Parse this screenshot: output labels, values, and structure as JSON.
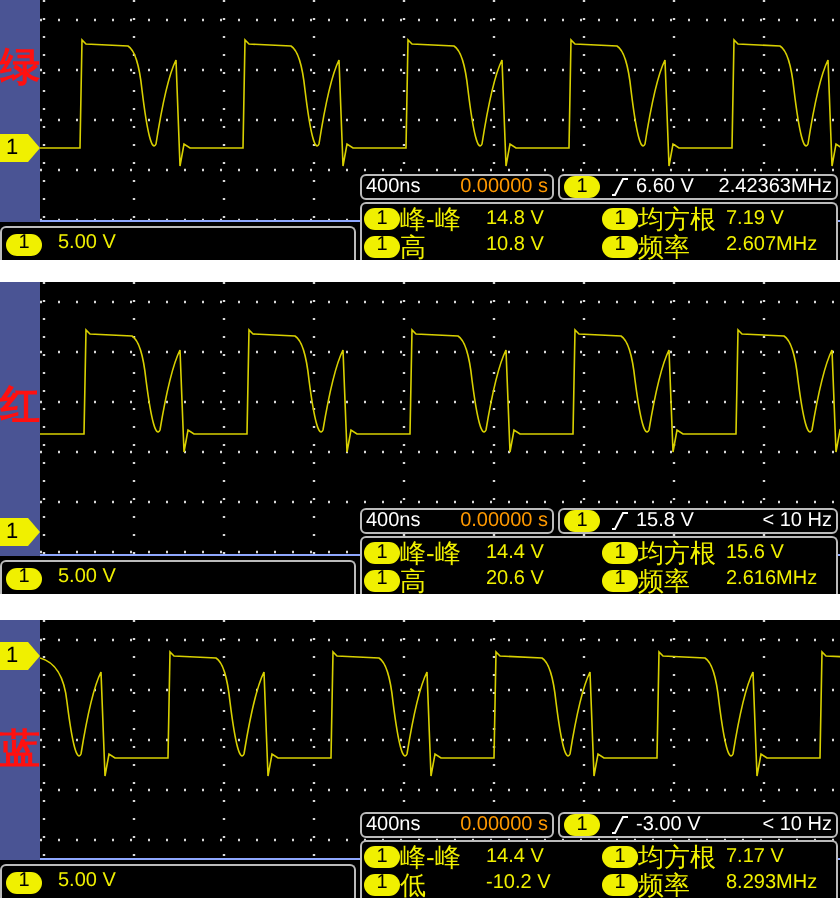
{
  "panels": [
    {
      "color_label": "绿",
      "channel_marker": "1",
      "timebase": "400ns",
      "trigger_position": "0.00000 s",
      "trigger": {
        "channel": "1",
        "level": "6.60 V",
        "frequency": "2.42363MHz"
      },
      "scale": {
        "channel": "1",
        "value": "5.00 V"
      },
      "measurements": [
        {
          "channel": "1",
          "name": "峰-峰",
          "value": "14.8 V"
        },
        {
          "channel": "1",
          "name": "均方根",
          "value": "7.19 V"
        },
        {
          "channel": "1",
          "name": "高",
          "value": "10.8 V"
        },
        {
          "channel": "1",
          "name": "频率",
          "value": "2.607MHz"
        }
      ]
    },
    {
      "color_label": "红",
      "channel_marker": "1",
      "timebase": "400ns",
      "trigger_position": "0.00000 s",
      "trigger": {
        "channel": "1",
        "level": "15.8 V",
        "frequency": "< 10 Hz"
      },
      "scale": {
        "channel": "1",
        "value": "5.00 V"
      },
      "measurements": [
        {
          "channel": "1",
          "name": "峰-峰",
          "value": "14.4 V"
        },
        {
          "channel": "1",
          "name": "均方根",
          "value": "15.6 V"
        },
        {
          "channel": "1",
          "name": "高",
          "value": "20.6 V"
        },
        {
          "channel": "1",
          "name": "频率",
          "value": "2.616MHz"
        }
      ]
    },
    {
      "color_label": "蓝",
      "channel_marker": "1",
      "timebase": "400ns",
      "trigger_position": "0.00000 s",
      "trigger": {
        "channel": "1",
        "level": "-3.00 V",
        "frequency": "< 10 Hz"
      },
      "scale": {
        "channel": "1",
        "value": "5.00 V"
      },
      "measurements": [
        {
          "channel": "1",
          "name": "峰-峰",
          "value": "14.4 V"
        },
        {
          "channel": "1",
          "name": "均方根",
          "value": "7.17 V"
        },
        {
          "channel": "1",
          "name": "低",
          "value": "-10.2 V"
        },
        {
          "channel": "1",
          "name": "频率",
          "value": "8.293MHz"
        }
      ]
    }
  ]
}
